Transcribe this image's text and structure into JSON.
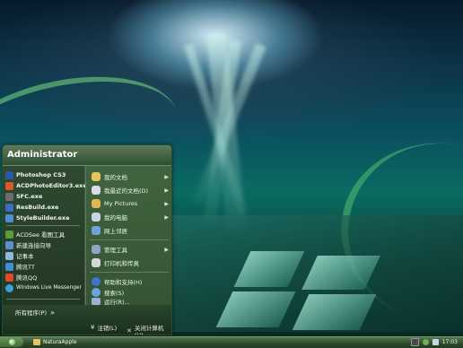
{
  "start_menu": {
    "user_name": "Administrator",
    "left_items": [
      {
        "label": "Photoshop CS3",
        "icon": "photoshop-icon",
        "color": "#2b59a8"
      },
      {
        "label": "ACDPhotoEditor3.exe",
        "icon": "acd-photo-editor-icon",
        "color": "#d35a2a"
      },
      {
        "label": "SFC.exe",
        "icon": "sfc-icon",
        "color": "#6c6c6c"
      },
      {
        "label": "ResBuild.exe",
        "icon": "resbuild-icon",
        "color": "#3a6dc9"
      },
      {
        "label": "StyleBuilder.exe",
        "icon": "stylebuilder-icon",
        "color": "#4a8fd8"
      },
      {
        "label": "ACDSee 看图工具",
        "icon": "acdsee-icon",
        "color": "#5a9c3a"
      },
      {
        "label": "新建连接向导",
        "icon": "network-wizard-icon",
        "color": "#5c8fd0"
      },
      {
        "label": "记事本",
        "icon": "notepad-icon",
        "color": "#8fb8e0"
      },
      {
        "label": "腾讯TT",
        "icon": "tencent-tt-icon",
        "color": "#3b8fd6"
      },
      {
        "label": "腾讯QQ",
        "icon": "qq-icon",
        "color": "#e04a2a"
      },
      {
        "label": "Windows Live Messenger",
        "icon": "messenger-icon",
        "color": "#3fa0d8"
      }
    ],
    "all_programs": "所有程序(P)",
    "right_items": [
      {
        "label": "我的文档",
        "icon": "my-documents-icon",
        "color": "#e7c45c",
        "arrow": true
      },
      {
        "label": "我最近的文档(D)",
        "icon": "recent-documents-icon",
        "color": "#d9dde6",
        "arrow": true
      },
      {
        "label": "My Pictures",
        "icon": "my-pictures-icon",
        "color": "#e3b54e",
        "arrow": true
      },
      {
        "label": "我的电脑",
        "icon": "my-computer-icon",
        "color": "#c9d6e6",
        "arrow": true
      },
      {
        "label": "网上邻居",
        "icon": "network-places-icon",
        "color": "#6ca6d9",
        "arrow": false
      },
      {
        "label": "管理工具",
        "icon": "admin-tools-icon",
        "color": "#8ea5c9",
        "arrow": true
      },
      {
        "label": "打印机和传真",
        "icon": "printers-icon",
        "color": "#d6d6d6",
        "arrow": false
      },
      {
        "label": "帮助和支持(H)",
        "icon": "help-icon",
        "color": "#3f74c9",
        "arrow": false
      },
      {
        "label": "搜索(S)",
        "icon": "search-icon",
        "color": "#6ea4d9",
        "arrow": false
      },
      {
        "label": "运行(R)...",
        "icon": "run-icon",
        "color": "#9bb3cf",
        "arrow": false
      }
    ],
    "log_off": "注销(L)",
    "shut_down": "关闭计算机(U)"
  },
  "taskbar": {
    "window_label": "NaturaApple",
    "clock": "17:03"
  }
}
